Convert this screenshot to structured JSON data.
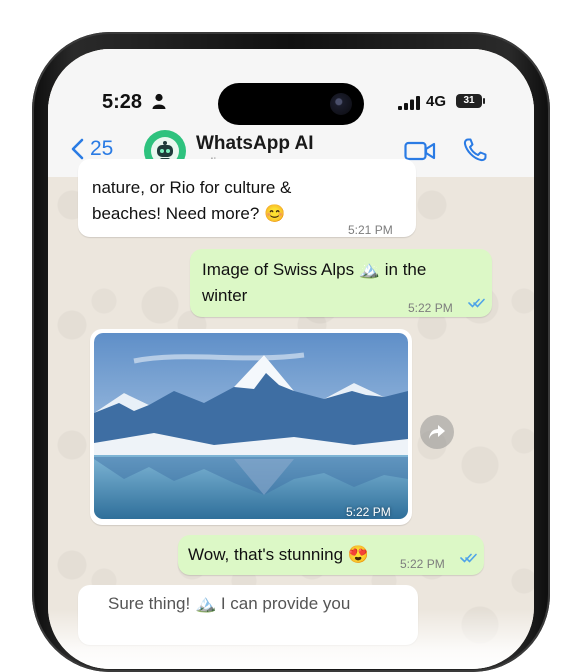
{
  "status_bar": {
    "time": "5:28",
    "network": "4G",
    "battery": "31"
  },
  "header": {
    "back_count": "25",
    "contact_name": "WhatsApp AI",
    "contact_status": "online"
  },
  "messages": [
    {
      "direction": "incoming",
      "lines": [
        "nature, or Rio for culture &",
        "beaches! Need more? 😊"
      ],
      "time": "5:21 PM"
    },
    {
      "direction": "outgoing",
      "lines": [
        "Image of Swiss Alps 🏔️ in the",
        "winter"
      ],
      "time": "5:22 PM",
      "read": true
    },
    {
      "direction": "incoming",
      "type": "image",
      "image_subject": "snowy mountain peak reflected in an alpine lake",
      "time": "5:22 PM"
    },
    {
      "direction": "outgoing",
      "lines": [
        "Wow, that's stunning 😍"
      ],
      "time": "5:22 PM",
      "read": true
    },
    {
      "direction": "incoming",
      "lines": [
        "Sure thing! 🏔️ I can provide you"
      ],
      "partial": true
    }
  ],
  "colors": {
    "accent": "#2a7be4",
    "outgoing_bubble": "#dcf8c6",
    "incoming_bubble": "#ffffff",
    "avatar_bg": "#2ec27e",
    "read_ticks": "#4fa3e8"
  }
}
